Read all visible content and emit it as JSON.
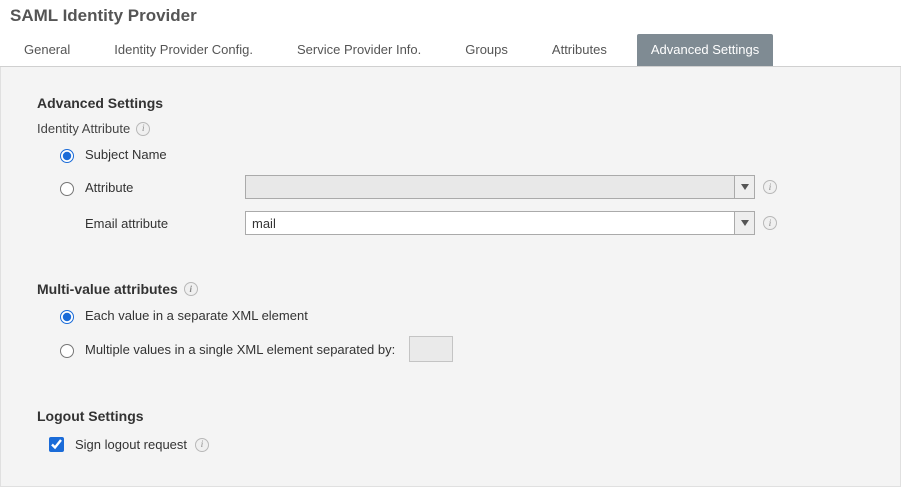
{
  "page_title": "SAML Identity Provider",
  "tabs": [
    {
      "label": "General"
    },
    {
      "label": "Identity Provider Config."
    },
    {
      "label": "Service Provider Info."
    },
    {
      "label": "Groups"
    },
    {
      "label": "Attributes"
    },
    {
      "label": "Advanced Settings",
      "active": true
    }
  ],
  "advanced": {
    "heading": "Advanced Settings",
    "identity_attribute_label": "Identity Attribute",
    "opt_subject_name": "Subject Name",
    "opt_attribute": "Attribute",
    "attribute_select_value": "",
    "email_attribute_label": "Email attribute",
    "email_attribute_value": "mail"
  },
  "multi": {
    "heading": "Multi-value attributes",
    "opt_separate": "Each value in a separate XML element",
    "opt_single": "Multiple values in a single XML element separated by:",
    "separator_value": ""
  },
  "logout": {
    "heading": "Logout Settings",
    "sign_label": "Sign logout request",
    "sign_checked": true
  }
}
